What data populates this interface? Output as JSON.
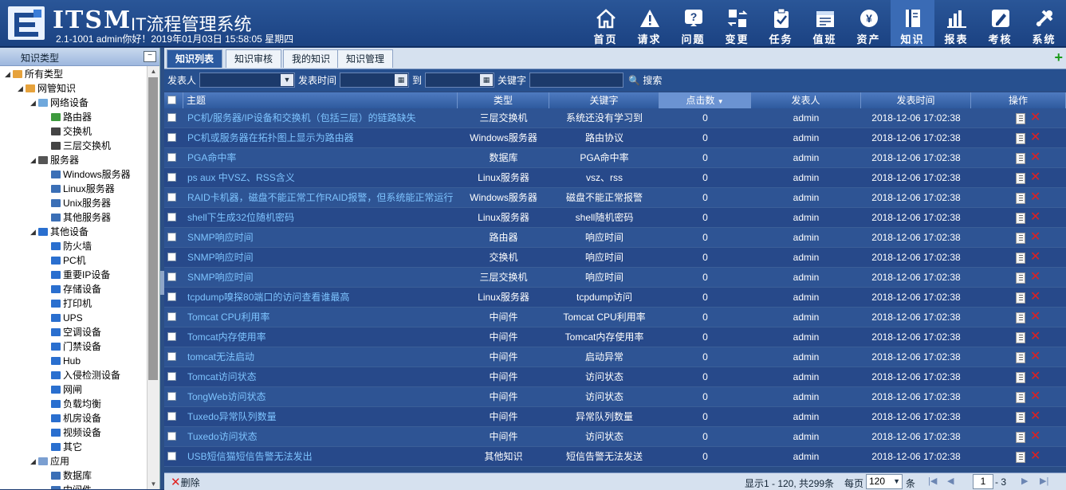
{
  "app": {
    "brand": "ITSM",
    "system_title": "IT流程管理系统",
    "user_line": "2.1-1001 admin你好！2019年01月03日 15:58:05 星期四"
  },
  "nav": [
    {
      "label": "首页",
      "icon": "home-icon"
    },
    {
      "label": "请求",
      "icon": "warning-icon"
    },
    {
      "label": "问题",
      "icon": "question-icon"
    },
    {
      "label": "变更",
      "icon": "change-icon"
    },
    {
      "label": "任务",
      "icon": "clipboard-icon"
    },
    {
      "label": "值班",
      "icon": "calendar-icon"
    },
    {
      "label": "资产",
      "icon": "yen-icon"
    },
    {
      "label": "知识",
      "icon": "book-icon",
      "active": true
    },
    {
      "label": "报表",
      "icon": "bar-chart-icon"
    },
    {
      "label": "考核",
      "icon": "pencil-icon"
    },
    {
      "label": "系统",
      "icon": "tools-icon"
    }
  ],
  "sidebar": {
    "title": "知识类型",
    "collapse": "−",
    "tree": [
      {
        "label": "所有类型",
        "level": 0,
        "expanded": true,
        "icon": "book-folder-icon"
      },
      {
        "label": "网管知识",
        "level": 1,
        "expanded": true,
        "icon": "book-folder-icon"
      },
      {
        "label": "网络设备",
        "level": 2,
        "expanded": true,
        "icon": "network-icon"
      },
      {
        "label": "路由器",
        "level": 3,
        "icon": "router-icon"
      },
      {
        "label": "交换机",
        "level": 3,
        "icon": "switch-icon"
      },
      {
        "label": "三层交换机",
        "level": 3,
        "icon": "switch-icon"
      },
      {
        "label": "服务器",
        "level": 2,
        "expanded": true,
        "icon": "server-group-icon"
      },
      {
        "label": "Windows服务器",
        "level": 3,
        "icon": "server-icon"
      },
      {
        "label": "Linux服务器",
        "level": 3,
        "icon": "server-icon"
      },
      {
        "label": "Unix服务器",
        "level": 3,
        "icon": "server-icon"
      },
      {
        "label": "其他服务器",
        "level": 3,
        "icon": "server-icon"
      },
      {
        "label": "其他设备",
        "level": 2,
        "expanded": true,
        "icon": "monitor-icon"
      },
      {
        "label": "防火墙",
        "level": 3,
        "icon": "monitor-icon"
      },
      {
        "label": "PC机",
        "level": 3,
        "icon": "monitor-icon"
      },
      {
        "label": "重要IP设备",
        "level": 3,
        "icon": "monitor-icon"
      },
      {
        "label": "存储设备",
        "level": 3,
        "icon": "monitor-icon"
      },
      {
        "label": "打印机",
        "level": 3,
        "icon": "monitor-icon"
      },
      {
        "label": "UPS",
        "level": 3,
        "icon": "monitor-icon"
      },
      {
        "label": "空调设备",
        "level": 3,
        "icon": "monitor-icon"
      },
      {
        "label": "门禁设备",
        "level": 3,
        "icon": "monitor-icon"
      },
      {
        "label": "Hub",
        "level": 3,
        "icon": "monitor-icon"
      },
      {
        "label": "入侵检测设备",
        "level": 3,
        "icon": "monitor-icon"
      },
      {
        "label": "网闸",
        "level": 3,
        "icon": "monitor-icon"
      },
      {
        "label": "负载均衡",
        "level": 3,
        "icon": "monitor-icon"
      },
      {
        "label": "机房设备",
        "level": 3,
        "icon": "monitor-icon"
      },
      {
        "label": "视频设备",
        "level": 3,
        "icon": "monitor-icon"
      },
      {
        "label": "其它",
        "level": 3,
        "icon": "monitor-icon"
      },
      {
        "label": "应用",
        "level": 2,
        "expanded": true,
        "icon": "app-icon"
      },
      {
        "label": "数据库",
        "level": 3,
        "icon": "database-icon"
      },
      {
        "label": "中间件",
        "level": 3,
        "icon": "database-icon"
      }
    ]
  },
  "tabs": [
    {
      "label": "知识列表",
      "active": true
    },
    {
      "label": "知识审核"
    },
    {
      "label": "我的知识"
    },
    {
      "label": "知识管理"
    }
  ],
  "filter": {
    "publisher_label": "发表人",
    "time_label": "发表时间",
    "to_label": "到",
    "keyword_label": "关键字",
    "search_label": "搜索"
  },
  "grid": {
    "columns": [
      "主题",
      "类型",
      "关键字",
      "点击数",
      "发表人",
      "发表时间",
      "操作"
    ],
    "rows": [
      [
        "PC机/服务器/IP设备和交换机（包括三层）的链路缺失",
        "三层交换机",
        "系统还没有学习到",
        "0",
        "admin",
        "2018-12-06 17:02:38"
      ],
      [
        "PC机或服务器在拓扑图上显示为路由器",
        "Windows服务器",
        "路由协议",
        "0",
        "admin",
        "2018-12-06 17:02:38"
      ],
      [
        "PGA命中率",
        "数据库",
        "PGA命中率",
        "0",
        "admin",
        "2018-12-06 17:02:38"
      ],
      [
        "ps aux 中VSZ、RSS含义",
        "Linux服务器",
        "vsz、rss",
        "0",
        "admin",
        "2018-12-06 17:02:38"
      ],
      [
        "RAID卡机器，磁盘不能正常工作RAID报警，但系统能正常运行",
        "Windows服务器",
        "磁盘不能正常报警",
        "0",
        "admin",
        "2018-12-06 17:02:38"
      ],
      [
        "shell下生成32位随机密码",
        "Linux服务器",
        "shell随机密码",
        "0",
        "admin",
        "2018-12-06 17:02:38"
      ],
      [
        "SNMP响应时间",
        "路由器",
        "响应时间",
        "0",
        "admin",
        "2018-12-06 17:02:38"
      ],
      [
        "SNMP响应时间",
        "交换机",
        "响应时间",
        "0",
        "admin",
        "2018-12-06 17:02:38"
      ],
      [
        "SNMP响应时间",
        "三层交换机",
        "响应时间",
        "0",
        "admin",
        "2018-12-06 17:02:38"
      ],
      [
        "tcpdump嗅探80端口的访问查看谁最高",
        "Linux服务器",
        "tcpdump访问",
        "0",
        "admin",
        "2018-12-06 17:02:38"
      ],
      [
        "Tomcat CPU利用率",
        "中间件",
        "Tomcat CPU利用率",
        "0",
        "admin",
        "2018-12-06 17:02:38"
      ],
      [
        "Tomcat内存使用率",
        "中间件",
        "Tomcat内存使用率",
        "0",
        "admin",
        "2018-12-06 17:02:38"
      ],
      [
        "tomcat无法启动",
        "中间件",
        "启动异常",
        "0",
        "admin",
        "2018-12-06 17:02:38"
      ],
      [
        "Tomcat访问状态",
        "中间件",
        "访问状态",
        "0",
        "admin",
        "2018-12-06 17:02:38"
      ],
      [
        "TongWeb访问状态",
        "中间件",
        "访问状态",
        "0",
        "admin",
        "2018-12-06 17:02:38"
      ],
      [
        "Tuxedo异常队列数量",
        "中间件",
        "异常队列数量",
        "0",
        "admin",
        "2018-12-06 17:02:38"
      ],
      [
        "Tuxedo访问状态",
        "中间件",
        "访问状态",
        "0",
        "admin",
        "2018-12-06 17:02:38"
      ],
      [
        "USB短信猫短信告警无法发出",
        "其他知识",
        "短信告警无法发送",
        "0",
        "admin",
        "2018-12-06 17:02:38"
      ]
    ]
  },
  "footer": {
    "delete_label": "删除",
    "range_text": "显示1 - 120, 共299条",
    "page_size_label": "每页",
    "page_size": "120",
    "page_size_unit": "条",
    "current_page": "1",
    "total_pages": "- 3"
  },
  "colors": {
    "link": "#7ec4ff",
    "delete": "#e02020",
    "header_bg": "#1b4282"
  }
}
